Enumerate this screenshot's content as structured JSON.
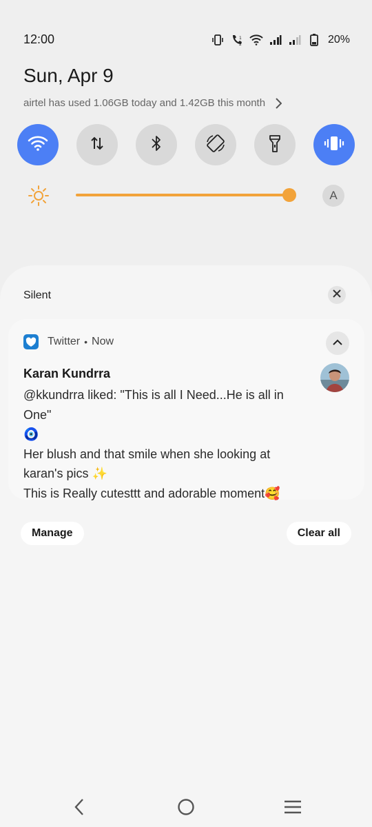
{
  "status_bar": {
    "time": "12:00",
    "battery_percent": "20%",
    "icons": [
      "vibrate-icon",
      "volte-call-icon",
      "wifi-icon",
      "signal-sim1-icon",
      "signal-sim2-icon",
      "battery-icon"
    ]
  },
  "header": {
    "date": "Sun, Apr 9",
    "usage_text": "airtel has used 1.06GB today and 1.42GB this month"
  },
  "quick_tiles": [
    {
      "name": "wifi",
      "icon": "wifi-icon",
      "active": true
    },
    {
      "name": "mobile-data",
      "icon": "data-arrows-icon",
      "active": false
    },
    {
      "name": "bluetooth",
      "icon": "bluetooth-icon",
      "active": false
    },
    {
      "name": "auto-rotate",
      "icon": "rotate-icon",
      "active": false
    },
    {
      "name": "flashlight",
      "icon": "flashlight-icon",
      "active": false
    },
    {
      "name": "vibrate",
      "icon": "vibrate-icon",
      "active": true
    }
  ],
  "brightness": {
    "level": 0.97,
    "auto_label": "A"
  },
  "notifications": {
    "section_title": "Silent",
    "card": {
      "app_name": "Twitter",
      "separator": "•",
      "time": "Now",
      "sender": "Karan Kundrra",
      "message_lines": [
        "@kkundrra liked: \"This is all I Need...He is all in",
        "One\"",
        "🧿",
        "Her blush and that smile when she looking at",
        "karan's pics ✨",
        "This is Really cutesttt and adorable moment🥰"
      ]
    },
    "manage_label": "Manage",
    "clear_all_label": "Clear all"
  },
  "colors": {
    "accent": "#4c7ff5",
    "slider": "#f2a33a",
    "tile_inactive": "#d9d9d9",
    "background": "#efefef"
  }
}
